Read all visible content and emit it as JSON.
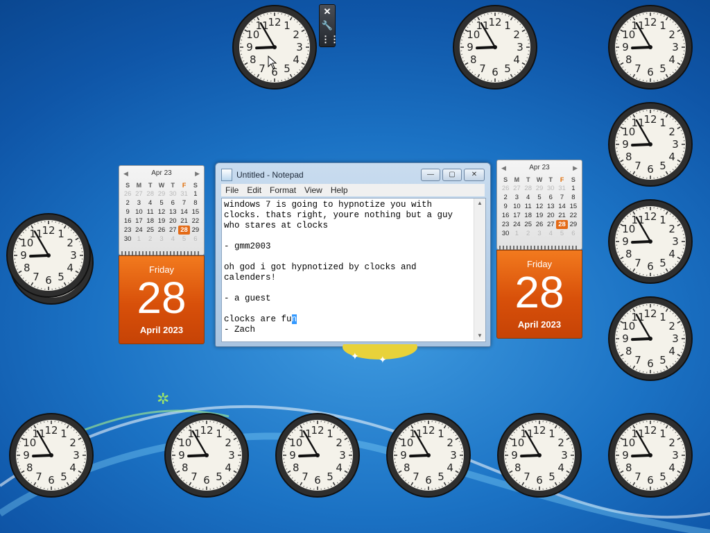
{
  "desktop": {
    "clock_count": 18
  },
  "gadget_toolbar": {
    "close_icon": "close-icon",
    "settings_icon": "wrench-icon",
    "drag_icon": "drag-grip-icon"
  },
  "clock": {
    "numbers": [
      "12",
      "1",
      "2",
      "3",
      "4",
      "5",
      "6",
      "7",
      "8",
      "9",
      "10",
      "11"
    ],
    "time_display": "8:55"
  },
  "calendars": [
    {
      "month_label": "Apr 23",
      "day_headers": [
        "S",
        "M",
        "T",
        "W",
        "T",
        "F",
        "S"
      ],
      "weekday": "Friday",
      "day": "28",
      "month_year": "April 2023"
    },
    {
      "month_label": "Apr 23",
      "day_headers": [
        "S",
        "M",
        "T",
        "W",
        "T",
        "F",
        "S"
      ],
      "weekday": "Friday",
      "day": "28",
      "month_year": "April 2023"
    }
  ],
  "calendar_days": [
    [
      "26",
      "27",
      "28",
      "29",
      "30",
      "31",
      "1"
    ],
    [
      "2",
      "3",
      "4",
      "5",
      "6",
      "7",
      "8"
    ],
    [
      "9",
      "10",
      "11",
      "12",
      "13",
      "14",
      "15"
    ],
    [
      "16",
      "17",
      "18",
      "19",
      "20",
      "21",
      "22"
    ],
    [
      "23",
      "24",
      "25",
      "26",
      "27",
      "28",
      "29"
    ],
    [
      "30",
      "1",
      "2",
      "3",
      "4",
      "5",
      "6"
    ]
  ],
  "notepad": {
    "title": "Untitled - Notepad",
    "menu": [
      "File",
      "Edit",
      "Format",
      "View",
      "Help"
    ],
    "text_before_selection": "windows 7 is going to hypnotize you with\nclocks. thats right, youre nothing but a guy\nwho stares at clocks\n\n- gmm2003\n\noh god i got hypnotized by clocks and\ncalenders!\n\n- a guest\n\nclocks are fu",
    "selected_text": "n",
    "text_after_selection": "\n- Zach",
    "minimize": "—",
    "maximize": "▢",
    "close": "✕"
  }
}
